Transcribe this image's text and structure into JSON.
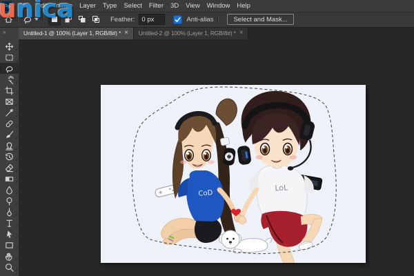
{
  "app": {
    "badge": "Ps"
  },
  "watermark": {
    "text": "unica"
  },
  "menu": {
    "items": [
      "File",
      "Edit",
      "Image",
      "Layer",
      "Type",
      "Select",
      "Filter",
      "3D",
      "View",
      "Window",
      "Help"
    ]
  },
  "options": {
    "feather_label": "Feather:",
    "feather_value": "0 px",
    "anti_alias_label": "Anti-alias",
    "anti_alias_checked": true,
    "select_and_mask_label": "Select and Mask...",
    "active_selection_mode": "new-selection"
  },
  "tab_strip": {
    "overflow_chevron": "»"
  },
  "tabs": [
    {
      "title": "Untitled-1 @ 100% (Layer 1, RGB/8#) *",
      "close": "×",
      "active": true
    },
    {
      "title": "Untitled-2 @ 100% (Layer 1, RGB/8#) *",
      "close": "×",
      "active": false
    }
  ],
  "toolbar": {
    "selected": "lasso",
    "tools": [
      "move",
      "rectangular-marquee",
      "lasso",
      "magic-wand",
      "crop",
      "frame",
      "eyedropper",
      "spot-healing-brush",
      "brush",
      "clone-stamp",
      "history-brush",
      "eraser",
      "gradient",
      "blur",
      "dodge",
      "pen",
      "type",
      "path-selection",
      "rectangle",
      "hand",
      "zoom"
    ]
  },
  "canvas": {
    "background": "#eef2f8",
    "artwork": {
      "girl_shirt_text": "CoD",
      "boy_shirt_text": "LoL",
      "description": "Chibi girl and boy with headphones holding hands; heart, white puppy, game-controller and phone doodles; dashed lasso selection around them"
    }
  },
  "colors": {
    "ui_bar": "#3b3b3b",
    "ui_options": "#383838",
    "ui_pasteboard": "#272727",
    "tab_active": "#4b4b4b",
    "accent_checkbox": "#1b72d8",
    "girl_shirt_blue": "#1f57c2",
    "boy_shorts_red": "#a6212d",
    "watermark_orange": "#f2664a",
    "watermark_blue": "#2187ca"
  }
}
